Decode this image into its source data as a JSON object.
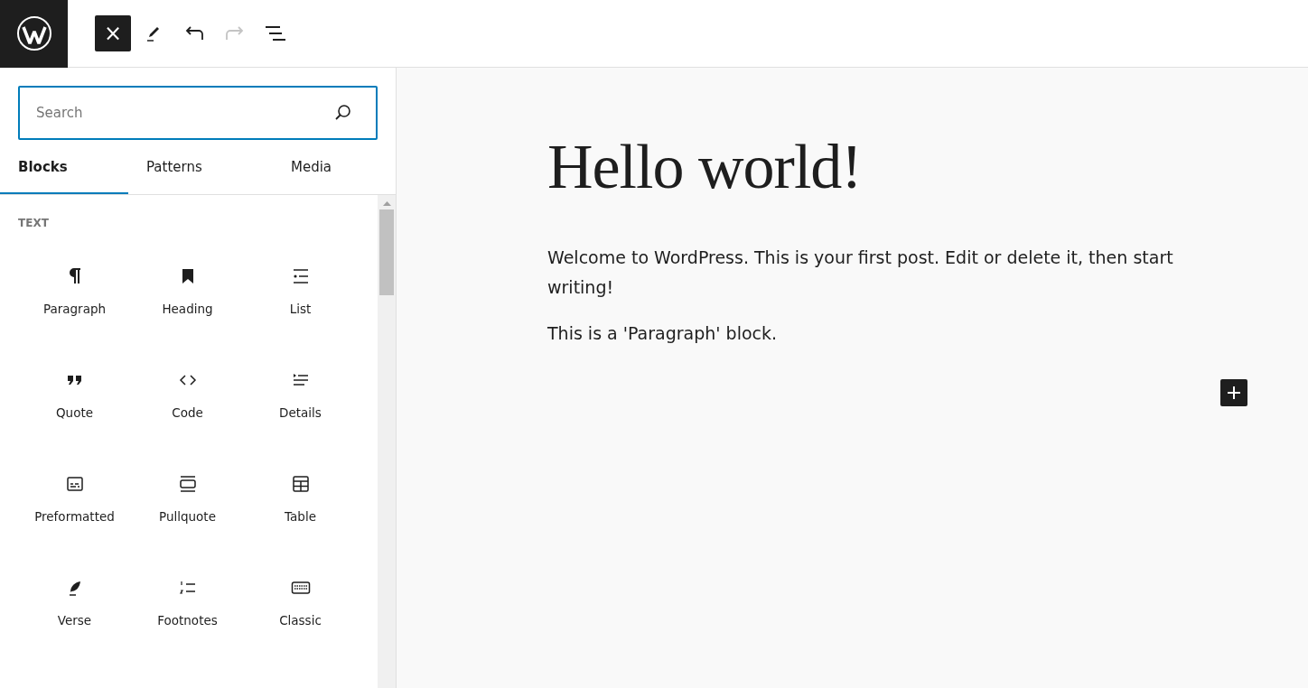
{
  "toolbar": {
    "buttons": [
      {
        "kind": "close",
        "label": "×",
        "selected": true,
        "disabled": false
      },
      {
        "kind": "pencil",
        "selected": false,
        "disabled": false
      },
      {
        "kind": "undo",
        "selected": false,
        "disabled": false
      },
      {
        "kind": "redo",
        "selected": false,
        "disabled": true
      },
      {
        "kind": "outline",
        "selected": false,
        "disabled": false
      }
    ]
  },
  "inserter": {
    "search": {
      "placeholder": "Search"
    },
    "tabs": [
      {
        "label": "Blocks",
        "selected": true
      },
      {
        "label": "Patterns",
        "selected": false
      },
      {
        "label": "Media",
        "selected": false
      }
    ],
    "category": "TEXT",
    "blocks": [
      {
        "kind": "paragraph",
        "label": "Paragraph"
      },
      {
        "kind": "heading",
        "label": "Heading"
      },
      {
        "kind": "list",
        "label": "List"
      },
      {
        "kind": "quote",
        "label": "Quote"
      },
      {
        "kind": "code",
        "label": "Code"
      },
      {
        "kind": "details",
        "label": "Details"
      },
      {
        "kind": "preformatted",
        "label": "Preformatted"
      },
      {
        "kind": "pullquote",
        "label": "Pullquote"
      },
      {
        "kind": "table",
        "label": "Table"
      },
      {
        "kind": "verse",
        "label": "Verse"
      },
      {
        "kind": "footnotes",
        "label": "Footnotes"
      },
      {
        "kind": "classic",
        "label": "Classic"
      }
    ]
  },
  "post": {
    "title": "Hello world!",
    "paragraphs": [
      "Welcome to WordPress. This is your first post. Edit or delete it, then start writing!",
      "This is a 'Paragraph' block."
    ]
  }
}
